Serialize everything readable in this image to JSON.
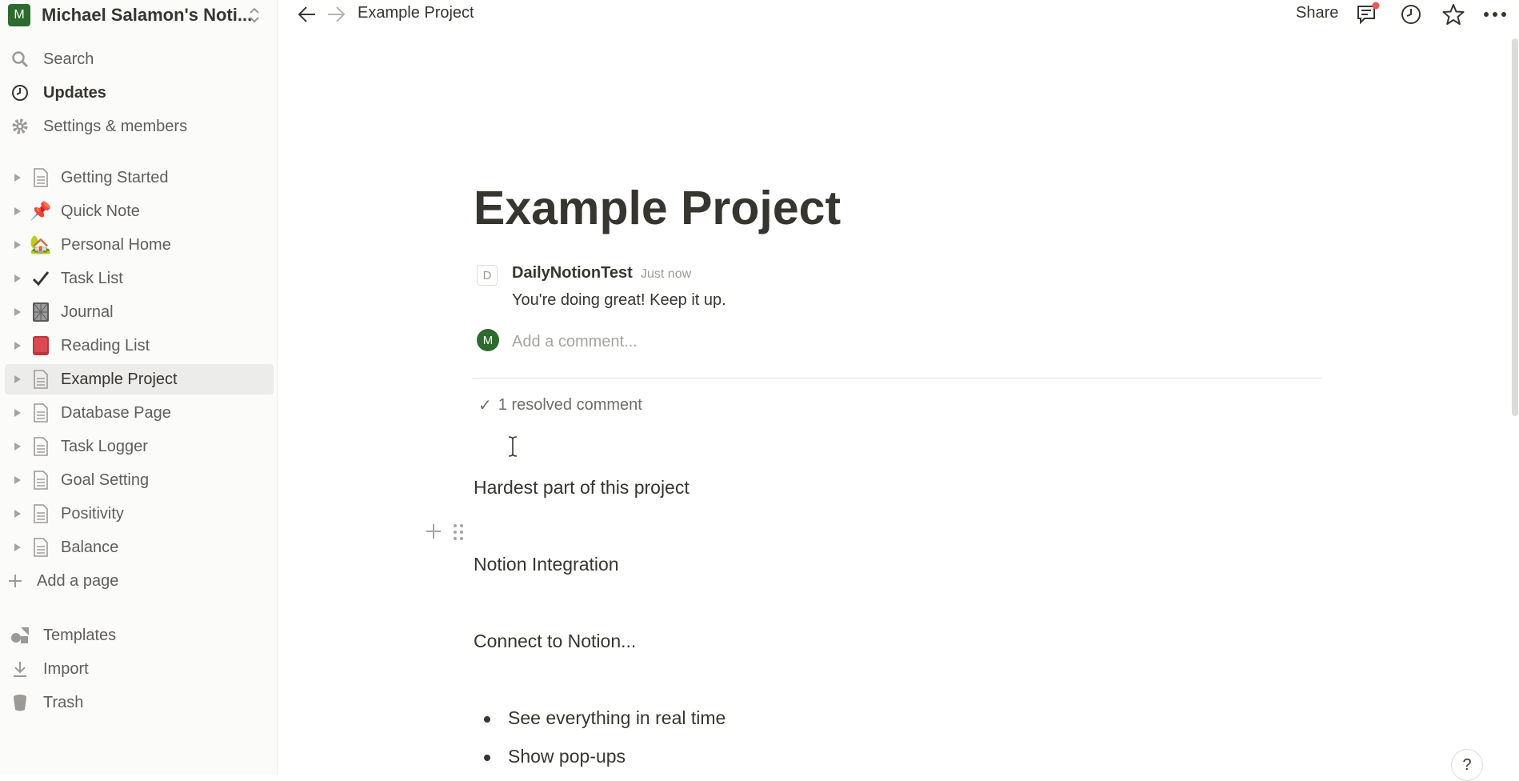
{
  "workspace": {
    "avatar_letter": "M",
    "name": "Michael Salamon's Noti...",
    "avatar_color": "#2d6a2d"
  },
  "sidebar": {
    "nav": [
      {
        "label": "Search",
        "icon": "search-icon"
      },
      {
        "label": "Updates",
        "icon": "clock-icon"
      },
      {
        "label": "Settings & members",
        "icon": "gear-icon"
      }
    ],
    "pages": [
      {
        "label": "Getting Started",
        "icon": "page-icon"
      },
      {
        "label": "Quick Note",
        "icon": "pushpin-icon",
        "emoji": "📌"
      },
      {
        "label": "Personal Home",
        "icon": "house-icon",
        "emoji": "🏡"
      },
      {
        "label": "Task List",
        "icon": "checkmark-icon",
        "emoji": "✔"
      },
      {
        "label": "Journal",
        "icon": "notebook-icon"
      },
      {
        "label": "Reading List",
        "icon": "book-icon"
      },
      {
        "label": "Example Project",
        "icon": "page-icon",
        "active": true
      },
      {
        "label": "Database Page",
        "icon": "page-icon"
      },
      {
        "label": "Task Logger",
        "icon": "page-icon"
      },
      {
        "label": "Goal Setting",
        "icon": "page-icon"
      },
      {
        "label": "Positivity",
        "icon": "page-icon"
      },
      {
        "label": "Balance",
        "icon": "page-icon"
      }
    ],
    "add_page": "Add a page",
    "bottom": [
      {
        "label": "Templates",
        "icon": "shapes-icon"
      },
      {
        "label": "Import",
        "icon": "download-icon"
      },
      {
        "label": "Trash",
        "icon": "trash-icon"
      }
    ]
  },
  "topbar": {
    "breadcrumb": "Example Project",
    "share": "Share",
    "notification_color": "#eb5757"
  },
  "page": {
    "title": "Example Project",
    "comment": {
      "author_initial": "D",
      "author": "DailyNotionTest",
      "time": "Just now",
      "text": "You're doing great! Keep it up."
    },
    "new_comment": {
      "avatar_letter": "M",
      "placeholder": "Add a comment..."
    },
    "resolved": "1 resolved comment",
    "blocks": {
      "b1": "Hardest part of this project",
      "b2": "Notion Integration",
      "b3": "Connect to Notion...",
      "bullets": [
        "See everything in real time",
        "Show pop-ups"
      ]
    },
    "help": "?"
  }
}
